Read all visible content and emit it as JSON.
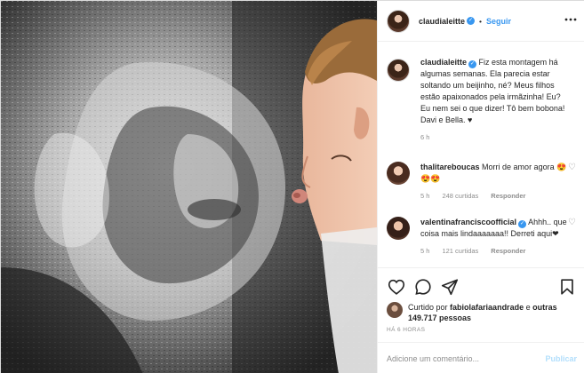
{
  "post": {
    "username": "claudialeitte",
    "verified": true,
    "follow_sep": "•",
    "follow_label": "Seguir",
    "caption": {
      "username": "claudialeitte",
      "text": "Fiz esta montagem há algumas semanas. Ela parecia estar soltando um beijinho, né? Meus filhos estão apaixonados pela irmãzinha! Eu? Eu nem sei o que dizer! Tô bem bobona! Davi e Bella. ♥",
      "time": "6 h"
    },
    "comments": [
      {
        "username": "thalitareboucas",
        "text": "Morri de amor agora 😍😍😍",
        "time": "5 h",
        "likes": "248 curtidas",
        "reply": "Responder"
      },
      {
        "username": "valentinafranciscoofficial",
        "verified": true,
        "text": "Ahhh.. que coisa mais lindaaaaaaa!! Derreti aqui❤",
        "time": "5 h",
        "likes": "121 curtidas",
        "reply": "Responder"
      }
    ],
    "liked_by_prefix": "Curtido por",
    "liked_by_user": "fabiolafariaandrade",
    "liked_by_middle": "e",
    "liked_by_others": "outras 149.717 pessoas",
    "timestamp": "HÁ 6 HORAS",
    "comment_placeholder": "Adicione um comentário...",
    "publish_label": "Publicar"
  },
  "icons": [
    "heart-icon",
    "comment-icon",
    "share-icon",
    "bookmark-icon",
    "more-options-icon",
    "verified-badge-icon"
  ],
  "colors": {
    "accent": "#3897f0",
    "text": "#262626",
    "muted": "#8e8e8e",
    "border": "#dbdbdb",
    "publish_disabled": "#b2dffc"
  }
}
